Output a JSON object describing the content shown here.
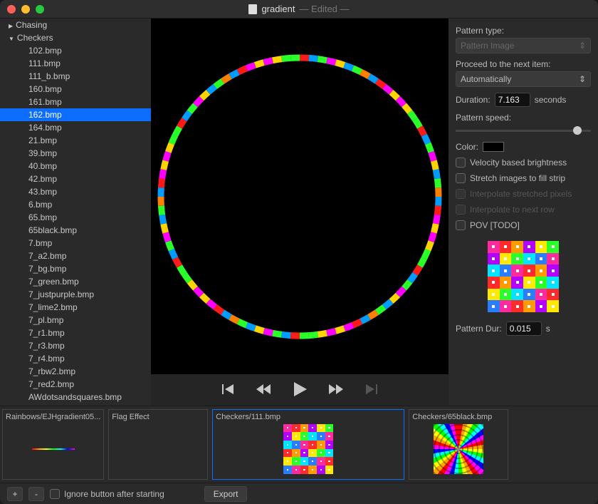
{
  "title": {
    "name": "gradient",
    "status": "— Edited —"
  },
  "sidebar": {
    "groups": [
      {
        "label": "Chasing",
        "expanded": false
      },
      {
        "label": "Checkers",
        "expanded": true
      }
    ],
    "files": [
      "102.bmp",
      "111.bmp",
      "111_b.bmp",
      "160.bmp",
      "161.bmp",
      "162.bmp",
      "164.bmp",
      "21.bmp",
      "39.bmp",
      "40.bmp",
      "42.bmp",
      "43.bmp",
      "6.bmp",
      "65.bmp",
      "65black.bmp",
      "7.bmp",
      "7_a2.bmp",
      "7_bg.bmp",
      "7_green.bmp",
      "7_justpurple.bmp",
      "7_lime2.bmp",
      "7_pl.bmp",
      "7_r1.bmp",
      "7_r3.bmp",
      "7_r4.bmp",
      "7_rbw2.bmp",
      "7_red2.bmp",
      "AWdotsandsquares.bmp"
    ],
    "selected_index": 5
  },
  "panel": {
    "pattern_type_label": "Pattern type:",
    "pattern_type_value": "Pattern Image",
    "proceed_label": "Proceed to the next item:",
    "proceed_value": "Automatically",
    "duration_label": "Duration:",
    "duration_value": "7.163",
    "duration_unit": "seconds",
    "speed_label": "Pattern speed:",
    "speed_value": 0.9,
    "color_label": "Color:",
    "color_value": "#000000",
    "opt_velocity": "Velocity based brightness",
    "opt_stretch": "Stretch images to fill strip",
    "opt_interp_px": "Interpolate stretched pixels",
    "opt_interp_row": "Interpolate to next row",
    "opt_pov": "POV [TODO]",
    "pattern_dur_label": "Pattern Dur:",
    "pattern_dur_value": "0.015",
    "pattern_dur_unit": "s"
  },
  "clips": [
    {
      "label": "Rainbows/EJHgradient05...",
      "kind": "rainbow"
    },
    {
      "label": "Flag Effect",
      "kind": "blank"
    },
    {
      "label": "Checkers/111.bmp",
      "kind": "checker",
      "selected": true
    },
    {
      "label": "Checkers/65black.bmp",
      "kind": "radial"
    }
  ],
  "footer": {
    "add": "+",
    "remove": "-",
    "ignore_label": "Ignore button after starting",
    "export_label": "Export"
  }
}
